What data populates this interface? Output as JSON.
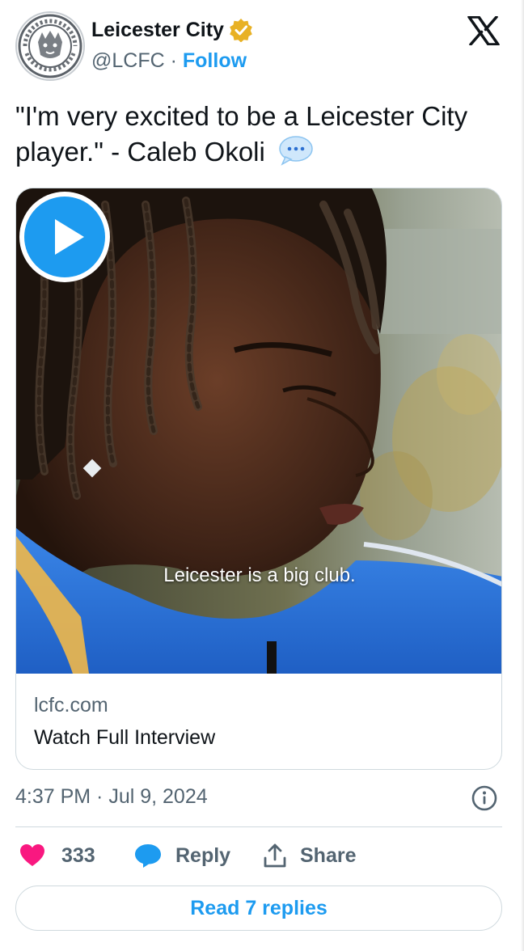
{
  "author": {
    "display_name": "Leicester City",
    "handle": "@LCFC",
    "separator": " · ",
    "follow_label": "Follow",
    "avatar_icon": "leicester-crest-icon",
    "verified_color": "#e8b124"
  },
  "brand_icon": "x-logo-icon",
  "tweet": {
    "text": "\"I'm very excited to be a Leicester City player.\" - Caleb Okoli",
    "emoji": "speech-balloon-icon"
  },
  "media": {
    "caption": "Leicester is a big club.",
    "play_icon": "play-icon",
    "link_domain": "lcfc.com",
    "link_title": "Watch Full Interview"
  },
  "meta": {
    "timestamp": "4:37 PM · Jul 9, 2024",
    "info_icon": "info-icon"
  },
  "actions": {
    "like_count": "333",
    "reply_label": "Reply",
    "share_label": "Share",
    "read_replies_label": "Read 7 replies"
  },
  "colors": {
    "accent": "#1d9bf0",
    "like": "#f91880",
    "muted_text": "#536471",
    "text": "#0f1419",
    "border": "#cfd9de",
    "jersey": "#2b6fd1"
  }
}
